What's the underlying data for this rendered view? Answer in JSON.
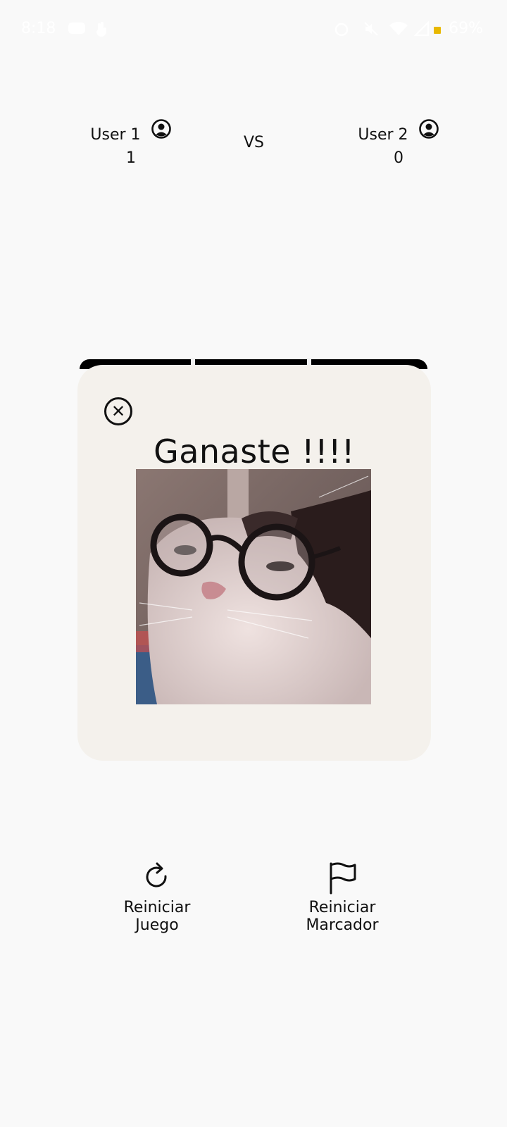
{
  "status_bar": {
    "time": "8:18",
    "battery": "69%"
  },
  "players": [
    {
      "name": "User 1",
      "score": "1",
      "icon": "account-circle-icon"
    },
    {
      "name": "User 2",
      "score": "0",
      "icon": "account-circle-icon"
    }
  ],
  "vs_label": "VS",
  "dialog": {
    "title": "Ganaste !!!!",
    "close_icon": "close-circle-icon",
    "image": "cat-with-glasses"
  },
  "actions": [
    {
      "label": "Reiniciar Juego",
      "icon": "refresh-icon"
    },
    {
      "label": "Reiniciar Marcador",
      "icon": "flag-icon"
    }
  ],
  "colors": {
    "background": "#f9f9f9",
    "dialog_bg": "#f4f1ec",
    "text": "#111111",
    "board_line": "#000000"
  }
}
